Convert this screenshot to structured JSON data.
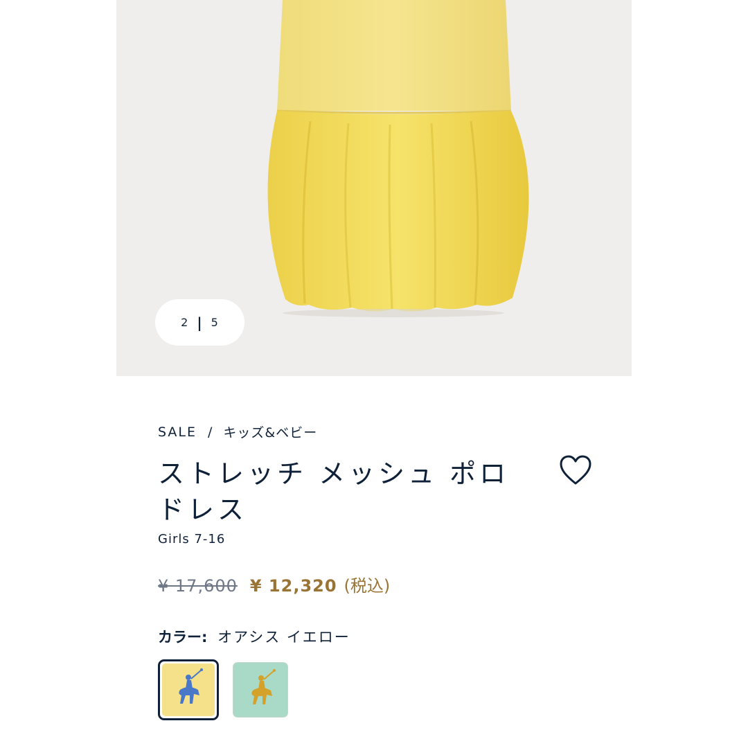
{
  "gallery": {
    "pager": {
      "current": "2",
      "separator": "|",
      "total": "5"
    }
  },
  "breadcrumb": {
    "parent": "SALE",
    "separator": "/",
    "category": "キッズ&ベビー"
  },
  "product": {
    "title": "ストレッチ メッシュ ポロ ドレス",
    "subtitle": "Girls 7-16",
    "wishlist_icon": "heart-outline-icon"
  },
  "price": {
    "original": "¥ 17,600",
    "sale": "¥ 12,320",
    "tax_note": "(税込)"
  },
  "color": {
    "label": "カラー:",
    "selected_name": "オアシス イエロー",
    "swatches": [
      {
        "name": "yellow",
        "bg": "#f5e18a",
        "logo": "#4a78c8",
        "selected": true
      },
      {
        "name": "mint",
        "bg": "#a9dac8",
        "logo": "#d4a12a",
        "selected": false
      }
    ]
  },
  "colors": {
    "navy": "#0f2138",
    "sale_gold": "#9a7434",
    "dress_yellow": "#f2dc5e",
    "image_bg": "#efeeed"
  }
}
